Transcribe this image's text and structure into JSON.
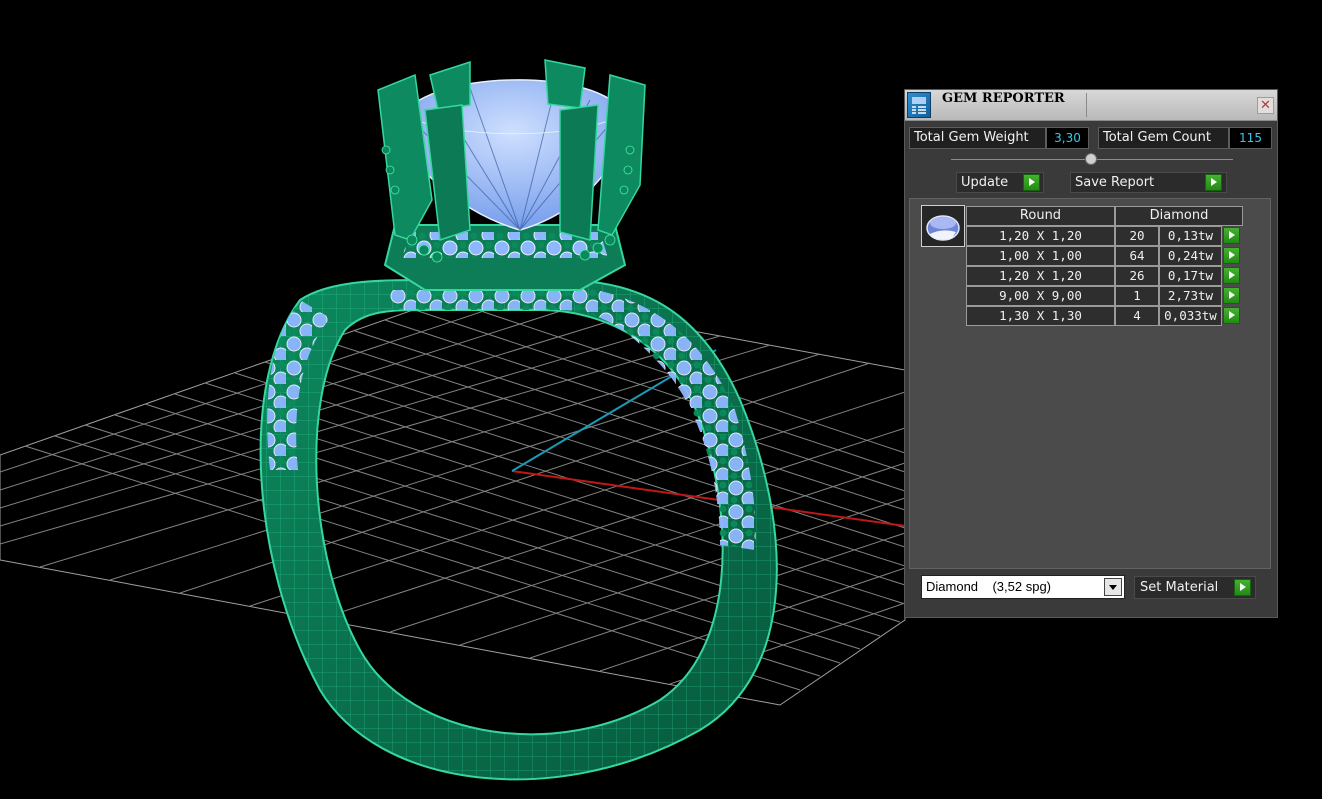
{
  "panel": {
    "title": "GEM REPORTER",
    "close": "✕",
    "total_weight_label": "Total Gem Weight",
    "total_weight_value": "3,30",
    "total_count_label": "Total Gem Count",
    "total_count_value": "115",
    "update_label": "Update",
    "save_report_label": "Save Report",
    "table": {
      "headers": [
        "Round",
        "Diamond"
      ],
      "rows": [
        {
          "size": "1,20 X 1,20",
          "count": "20",
          "weight": "0,13tw"
        },
        {
          "size": "1,00 X 1,00",
          "count": "64",
          "weight": "0,24tw"
        },
        {
          "size": "1,20 X 1,20",
          "count": "26",
          "weight": "0,17tw"
        },
        {
          "size": "9,00 X 9,00",
          "count": "1",
          "weight": "2,73tw"
        },
        {
          "size": "1,30 X 1,30",
          "count": "4",
          "weight": "0,033tw"
        }
      ]
    },
    "material_select": "Diamond    (3,52 spg)",
    "set_material_label": "Set Material"
  },
  "colors": {
    "ring_green": "#0b7a55",
    "ring_wire": "#2fd39a",
    "gem_blue": "#8ab4ff",
    "grid": "#9a9a9a",
    "axis_x": "#c01818",
    "axis_y": "#1a9bb5",
    "accent_value": "#39c7e8",
    "play_green": "#2fa01f"
  }
}
